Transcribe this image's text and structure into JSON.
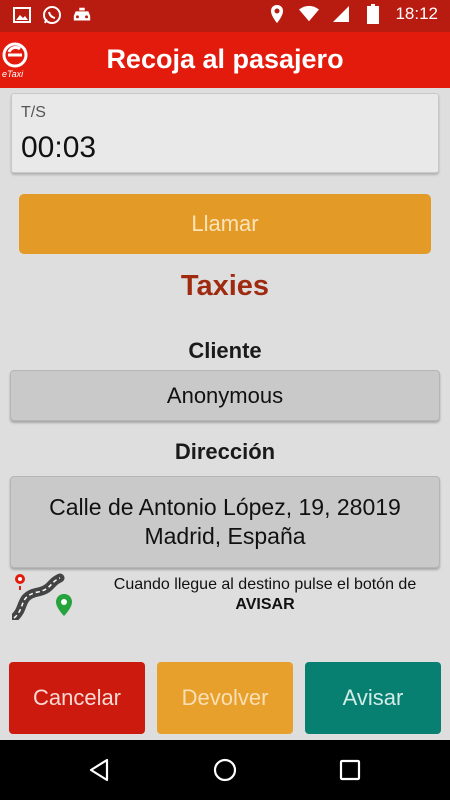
{
  "status_bar": {
    "time": "18:12",
    "left_icons": [
      "image-icon",
      "whatsapp-icon",
      "taxi-icon"
    ],
    "right_icons": [
      "location-icon",
      "wifi-icon",
      "signal-icon",
      "battery-icon"
    ]
  },
  "app_bar": {
    "title": "Recoja al pasajero",
    "logo_text": "eTaxi"
  },
  "timer": {
    "label": "T/S",
    "value": "00:03"
  },
  "call_button": {
    "label": "Llamar"
  },
  "company_name": "Taxies",
  "client": {
    "label": "Cliente",
    "value": "Anonymous"
  },
  "address": {
    "label": "Dirección",
    "value": "Calle de Antonio López, 19, 28019 Madrid, España"
  },
  "info": {
    "text_before": "Cuando llegue al destino pulse el botón de ",
    "text_bold": "AVISAR"
  },
  "actions": {
    "cancel_label": "Cancelar",
    "return_label": "Devolver",
    "notify_label": "Avisar"
  },
  "colors": {
    "status_bar": "#b81b10",
    "app_bar": "#e21b0c",
    "call_button": "#e49a26",
    "company": "#9e2a10",
    "cancel": "#cc1a0e",
    "return": "#e8a02c",
    "notify": "#078071"
  },
  "navigation": {
    "icons": [
      "back-icon",
      "home-icon",
      "recents-icon"
    ]
  }
}
